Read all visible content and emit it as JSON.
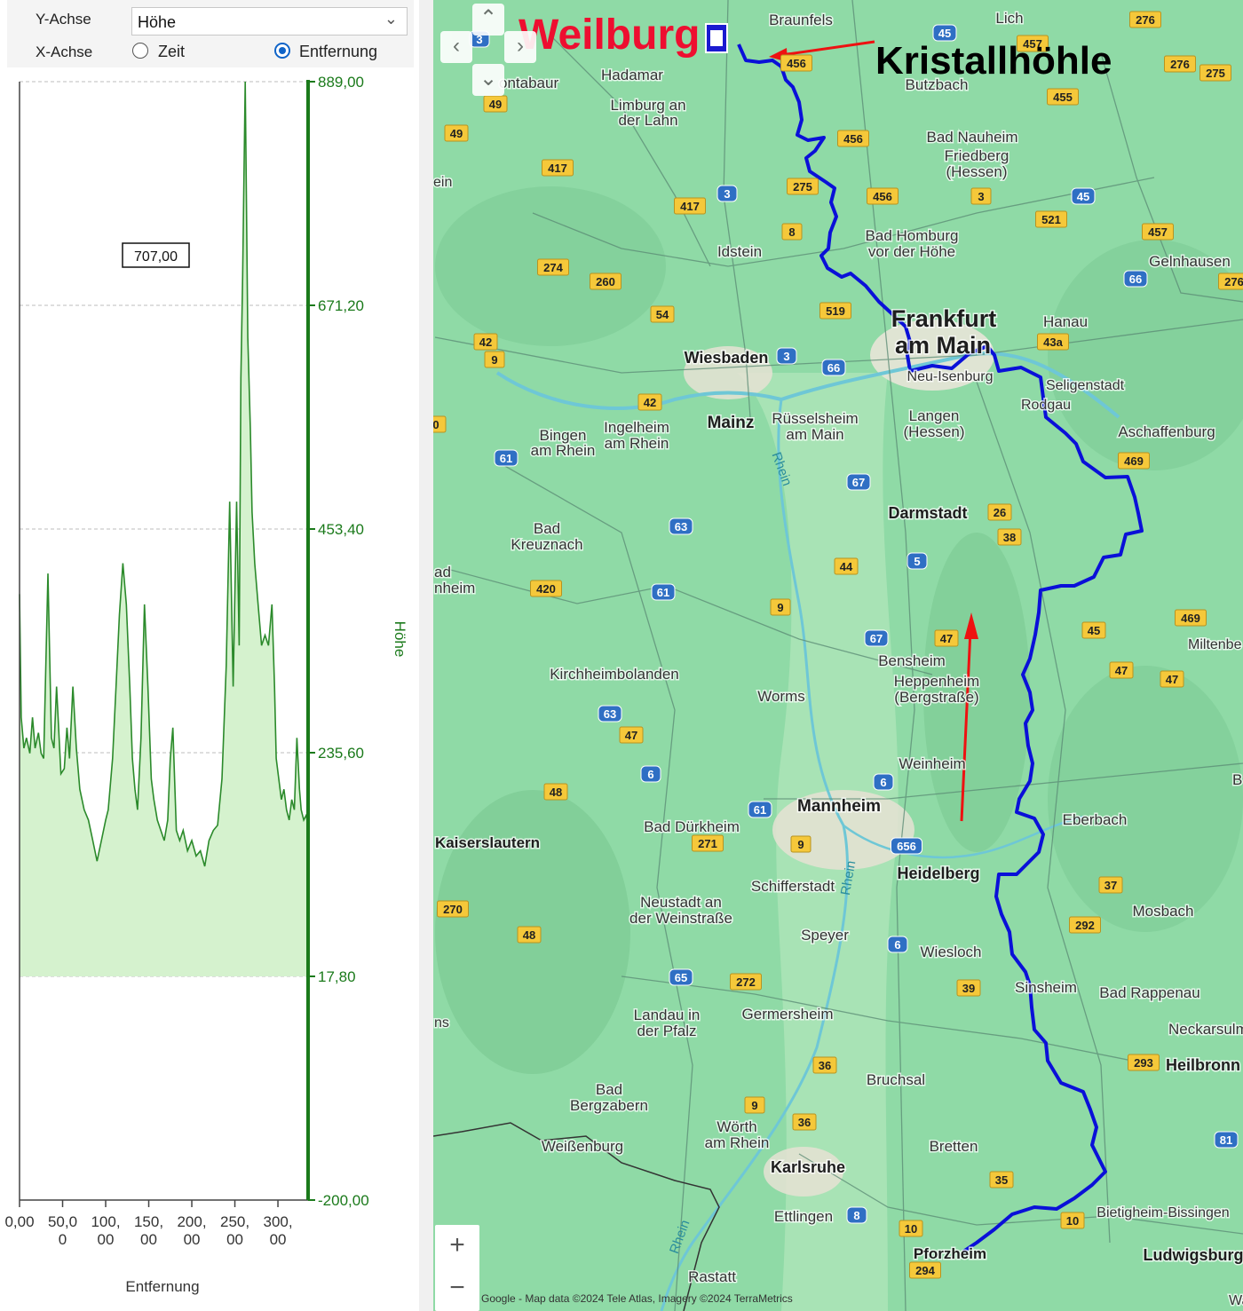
{
  "controls": {
    "y_axis_label": "Y-Achse",
    "y_axis_value": "Höhe",
    "x_axis_label": "X-Achse",
    "x_option_time": "Zeit",
    "x_option_distance": "Entfernung",
    "x_selected": "Entfernung"
  },
  "tooltip_value": "707,00",
  "chart_data": {
    "type": "area",
    "xlabel": "Entfernung",
    "ylabel": "Höhe",
    "ylim": [
      -200,
      889
    ],
    "xlim": [
      0,
      335
    ],
    "y_ticks": [
      "889,00",
      "671,20",
      "453,40",
      "235,60",
      "17,80",
      "-200,00"
    ],
    "x_ticks": [
      {
        "line1": "0,00",
        "line2": ""
      },
      {
        "line1": "50,0",
        "line2": "0"
      },
      {
        "line1": "100,",
        "line2": "00"
      },
      {
        "line1": "150,",
        "line2": "00"
      },
      {
        "line1": "200,",
        "line2": "00"
      },
      {
        "line1": "250,",
        "line2": "00"
      },
      {
        "line1": "300,",
        "line2": "00"
      }
    ],
    "grid": true,
    "fill_baseline": 17.8,
    "colors": {
      "line": "#2b8a2b",
      "fill": "#d5f2ce",
      "axis": "#1b7a1b"
    },
    "x": [
      0,
      2,
      5,
      8,
      12,
      15,
      18,
      22,
      25,
      28,
      33,
      37,
      40,
      43,
      48,
      52,
      55,
      58,
      62,
      66,
      70,
      75,
      80,
      85,
      90,
      95,
      100,
      103,
      108,
      112,
      116,
      120,
      124,
      128,
      131,
      134,
      137,
      141,
      145,
      149,
      153,
      156,
      160,
      164,
      168,
      172,
      175,
      178,
      182,
      186,
      190,
      195,
      200,
      205,
      210,
      215,
      220,
      225,
      230,
      235,
      240,
      244,
      248,
      252,
      255,
      257,
      259,
      262,
      265,
      268,
      270,
      273,
      277,
      281,
      285,
      289,
      293,
      296,
      298,
      301,
      304,
      307,
      310,
      313,
      316,
      319,
      322,
      325,
      327,
      330,
      333,
      335
    ],
    "y": [
      390,
      270,
      240,
      250,
      235,
      270,
      240,
      255,
      235,
      230,
      410,
      250,
      240,
      300,
      215,
      220,
      260,
      230,
      300,
      240,
      200,
      180,
      170,
      150,
      130,
      150,
      170,
      180,
      230,
      300,
      370,
      420,
      380,
      300,
      230,
      200,
      180,
      250,
      380,
      300,
      210,
      190,
      170,
      160,
      150,
      170,
      230,
      260,
      160,
      150,
      160,
      140,
      150,
      135,
      140,
      125,
      150,
      160,
      165,
      210,
      320,
      480,
      300,
      480,
      340,
      600,
      700,
      889,
      640,
      550,
      470,
      420,
      380,
      340,
      350,
      340,
      380,
      300,
      230,
      210,
      190,
      200,
      180,
      170,
      190,
      180,
      250,
      200,
      180,
      170,
      175,
      160
    ]
  },
  "map": {
    "places": {
      "weilburg": "Weilburg",
      "kristallhoehle": "Kristallhöhle",
      "frankfurt_1": "Frankfurt",
      "frankfurt_2": "am Main",
      "darmstadt": "Darmstadt",
      "mannheim": "Mannheim",
      "heidelberg": "Heidelberg",
      "karlsruhe": "Karlsruhe",
      "pforzheim": "Pforzheim",
      "wiesbaden": "Wiesbaden",
      "mainz": "Mainz",
      "braunfels": "Braunfels",
      "lich": "Lich",
      "hadamar": "Hadamar",
      "montabaur": "ontabaur",
      "limburg_1": "Limburg an",
      "limburg_2": "der Lahn",
      "butzbach": "Butzbach",
      "bad_nauheim": "Bad Nauheim",
      "friedberg_1": "Friedberg",
      "friedberg_2": "(Hessen)",
      "idstein": "Idstein",
      "bad_homburg_1": "Bad Homburg",
      "bad_homburg_2": "vor der Höhe",
      "gelnhausen": "Gelnhausen",
      "hanau": "Hanau",
      "neu_isenburg": "Neu-Isenburg",
      "seligenstadt": "Seligenstadt",
      "rodgau": "Rodgau",
      "aschaffenburg": "Aschaffenburg",
      "ruesselsheim_1": "Rüsselsheim",
      "ruesselsheim_2": "am Main",
      "langen_1": "Langen",
      "langen_2": "(Hessen)",
      "ingelheim_1": "Ingelheim",
      "ingelheim_2": "am Rhein",
      "bingen_1": "Bingen",
      "bingen_2": "am Rhein",
      "bad_kreuznach_1": "Bad",
      "bad_kreuznach_2": "Kreuznach",
      "bad_sobernheim_1": "ad",
      "bad_sobernheim_2": "nheim",
      "kirchheimbolanden": "Kirchheimbolanden",
      "worms": "Worms",
      "bensheim": "Bensheim",
      "heppenheim_1": "Heppenheim",
      "heppenheim_2": "(Bergstraße)",
      "weinheim": "Weinheim",
      "miltenberg": "Miltenbe",
      "eberbach": "Eberbach",
      "bad_duerkheim": "Bad Dürkheim",
      "kaiserslautern": "Kaiserslautern",
      "schifferstadt": "Schifferstadt",
      "neustadt_1": "Neustadt an",
      "neustadt_2": "der Weinstraße",
      "speyer": "Speyer",
      "wiesloch": "Wiesloch",
      "mosbach": "Mosbach",
      "sinsheim": "Sinsheim",
      "bad_rappenau": "Bad Rappenau",
      "neckarsulm": "Neckarsulm",
      "heilbronn": "Heilbronn",
      "landau_1": "Landau in",
      "landau_2": "der Pfalz",
      "germersheim": "Germersheim",
      "bruchsal": "Bruchsal",
      "bad_bergzabern_1": "Bad",
      "bad_bergzabern_2": "Bergzabern",
      "woerth_1": "Wörth",
      "woerth_2": "am Rhein",
      "weissenburg": "Weißenburg",
      "bretten": "Bretten",
      "bietigheim": "Bietigheim-Bissingen",
      "ettlingen": "Ettlingen",
      "ludwigsburg": "Ludwigsburg",
      "rastatt": "Rastatt",
      "ein": "ein",
      "ns": "ns",
      "rhein_1": "Rhein",
      "rhein_2": "Rhein",
      "rhein_3": "Rhein",
      "wai": "Wai",
      "b_edge": "B"
    },
    "road_badges": {
      "a3a": "3",
      "a45a": "45",
      "a456a": "456",
      "a457": "457",
      "a276a": "276",
      "a276b": "276",
      "a275a": "275",
      "a49a": "49",
      "a49b": "49",
      "a417a": "417",
      "a456b": "456",
      "a455": "455",
      "a3b": "3",
      "a275b": "275",
      "a456c": "456",
      "a3c": "3",
      "a45b": "45",
      "a417b": "417",
      "a521": "521",
      "a8": "8",
      "a457b": "457",
      "a274": "274",
      "a260": "260",
      "a519": "519",
      "a66a": "66",
      "a276c": "276",
      "a54": "54",
      "a42a": "42",
      "a9a": "9",
      "a3d": "3",
      "a66b": "66",
      "a43a": "43a",
      "a42b": "42",
      "a0": "0",
      "a61a": "61",
      "a67a": "67",
      "a469a": "469",
      "a26": "26",
      "a38": "38",
      "a63a": "63",
      "a5": "5",
      "a44": "44",
      "a420": "420",
      "a61b": "61",
      "a9b": "9",
      "a67b": "67",
      "a47a": "47",
      "a45c": "45",
      "a469b": "469",
      "a47b": "47",
      "a47c": "47",
      "a63b": "63",
      "a47d": "47",
      "a6a": "6",
      "a48a": "48",
      "a6b": "6",
      "a61c": "61",
      "a271": "271",
      "a9c": "9",
      "a656": "656",
      "a270": "270",
      "a48b": "48",
      "a37": "37",
      "a292": "292",
      "a6c": "6",
      "a65": "65",
      "a272": "272",
      "a39": "39",
      "a36a": "36",
      "a293": "293",
      "a81": "81",
      "a9d": "9",
      "a36b": "36",
      "a35": "35",
      "a8b": "8",
      "a10a": "10",
      "a10b": "10",
      "a294": "294"
    },
    "copyright": "Google - Map data ©2024 Tele Atlas, Imagery ©2024 TerraMetrics",
    "zoom_in": "+",
    "zoom_out": "−",
    "colors": {
      "route": "#0a10d8",
      "annotation": "#ee1111",
      "weilburg_text": "#ee0e30",
      "land": "#8fdaa6"
    }
  }
}
